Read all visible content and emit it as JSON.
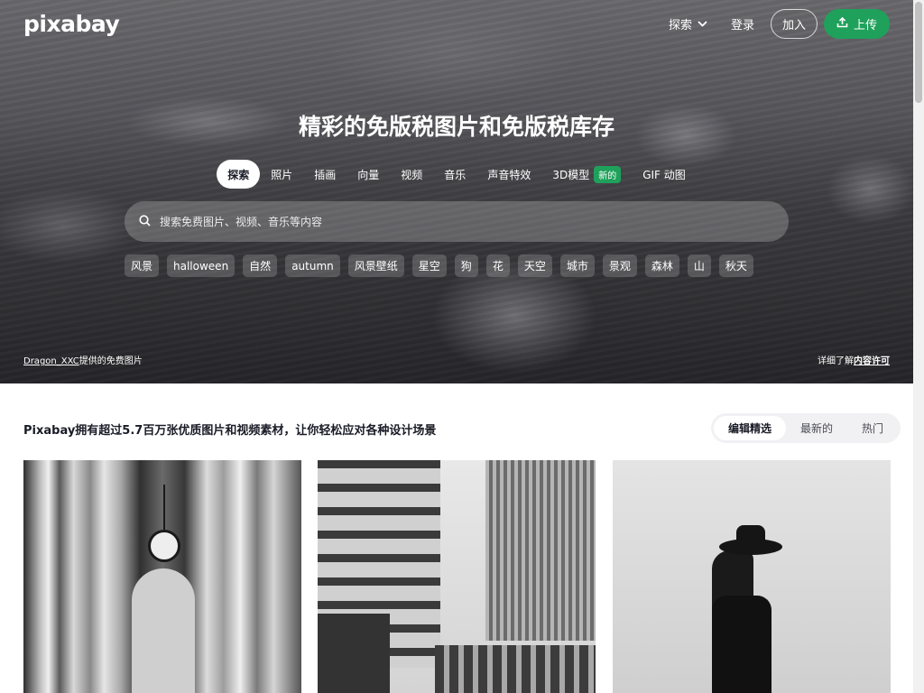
{
  "brand": {
    "logo": "pixabay"
  },
  "topnav": {
    "explore": "探索",
    "login": "登录",
    "join": "加入",
    "upload": "上传"
  },
  "hero": {
    "headline": "精彩的免版税图片和免版税库存",
    "tabs": [
      {
        "label": "探索",
        "active": true
      },
      {
        "label": "照片"
      },
      {
        "label": "插画"
      },
      {
        "label": "向量"
      },
      {
        "label": "视频"
      },
      {
        "label": "音乐"
      },
      {
        "label": "声音特效"
      },
      {
        "label": "3D模型",
        "badge": "新的"
      },
      {
        "label": "GIF 动图"
      }
    ],
    "search_placeholder": "搜索免费图片、视频、音乐等内容",
    "chips": [
      "风景",
      "halloween",
      "自然",
      "autumn",
      "风景壁纸",
      "星空",
      "狗",
      "花",
      "天空",
      "城市",
      "景观",
      "森林",
      "山",
      "秋天"
    ],
    "credit_author": "Dragon_XXC",
    "credit_suffix": "提供的免费图片",
    "license_prefix": "详细了解",
    "license_link": "内容许可"
  },
  "section": {
    "title": "Pixabay拥有超过5.7百万张优质图片和视频素材，让你轻松应对各种设计场景",
    "sort": [
      {
        "label": "编辑精选",
        "active": true
      },
      {
        "label": "最新的"
      },
      {
        "label": "热门"
      }
    ]
  },
  "colors": {
    "accent": "#1fa15b",
    "text": "#191b26"
  }
}
